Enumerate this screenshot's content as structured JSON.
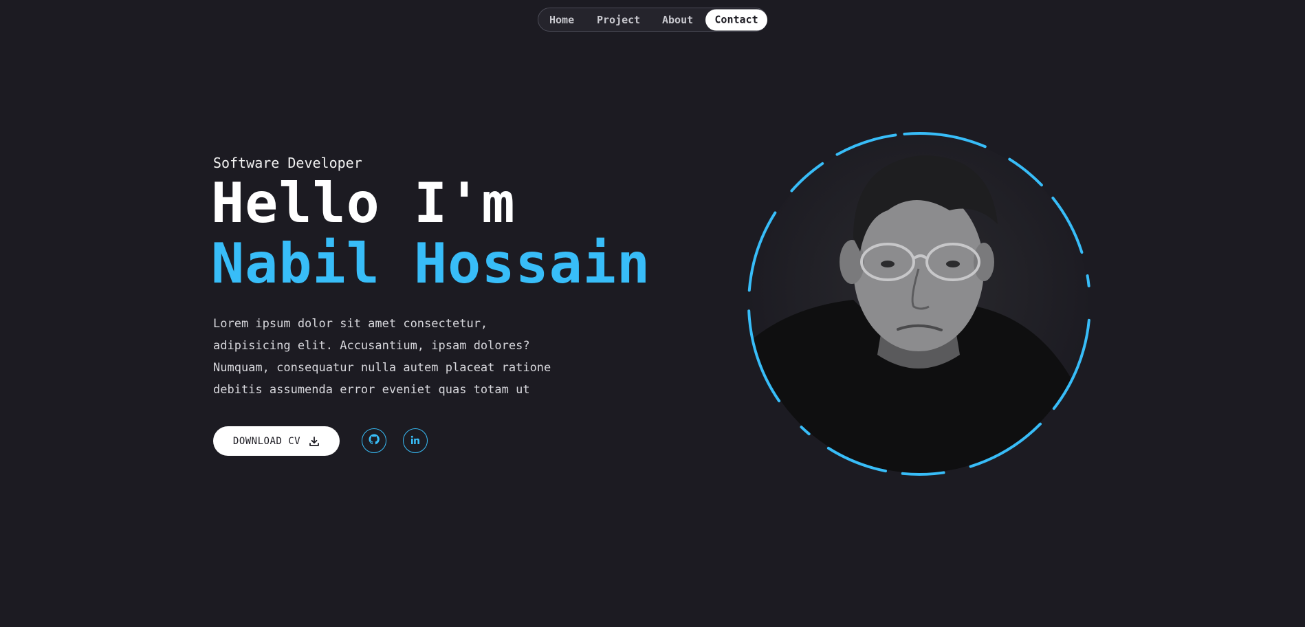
{
  "nav": {
    "items": [
      {
        "label": "Home"
      },
      {
        "label": "Project"
      },
      {
        "label": "About"
      },
      {
        "label": "Contact"
      }
    ],
    "active": "Contact"
  },
  "hero": {
    "subtitle": "Software Developer",
    "greeting": "Hello I'm",
    "name": "Nabil Hossain",
    "description": "Lorem ipsum dolor sit amet consectetur, adipisicing elit. Accusantium, ipsam dolores? Numquam, consequatur nulla autem placeat ratione debitis assumenda error eveniet quas totam ut",
    "cv_button_label": "DOWNLOAD CV",
    "social": [
      {
        "icon": "github-icon"
      },
      {
        "icon": "linkedin-icon"
      }
    ]
  },
  "portrait": {
    "alt": "portrait photo"
  },
  "colors": {
    "background": "#1c1b22",
    "accent": "#38bdf8",
    "text": "#ffffff",
    "muted_text": "#d7d7dc"
  }
}
